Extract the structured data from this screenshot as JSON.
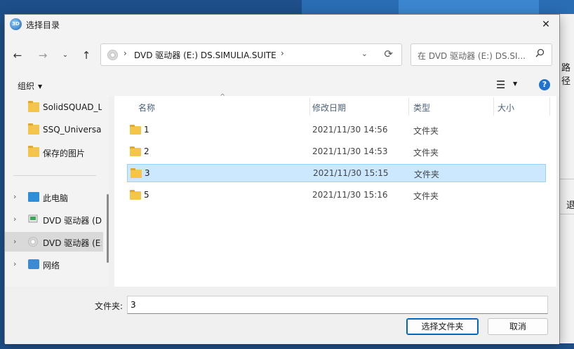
{
  "background": {
    "right_text_1": "路径",
    "right_text_2": "退"
  },
  "dialog": {
    "title": "选择目录",
    "close_glyph": "✕"
  },
  "nav": {
    "back": "←",
    "forward": "→",
    "dropdown": "⌄",
    "up": "↑"
  },
  "address": {
    "sep": "›",
    "path": "DVD 驱动器 (E:) DS.SIMULIA.SUITE",
    "dropdown": "⌄",
    "refresh": "⟳"
  },
  "search": {
    "placeholder": "在 DVD 驱动器 (E:) DS.SI...",
    "icon": "search-icon"
  },
  "toolbar": {
    "organize_label": "组织",
    "organize_caret": "▼",
    "view_glyph": "☰",
    "view_caret": "▼",
    "help_glyph": "?"
  },
  "navpane": {
    "items": [
      {
        "label": "SolidSQUAD_Li",
        "icon": "folder-icon",
        "chevron": ""
      },
      {
        "label": "SSQ_UniversalI",
        "icon": "folder-icon",
        "chevron": ""
      },
      {
        "label": "保存的图片",
        "icon": "folder-icon",
        "chevron": ""
      },
      {
        "label": "此电脑",
        "icon": "computer-icon",
        "chevron": "›"
      },
      {
        "label": "DVD 驱动器 (D",
        "icon": "dvd-installer-icon",
        "chevron": "›"
      },
      {
        "label": "DVD 驱动器 (E:",
        "icon": "dvd-drive-icon",
        "chevron": "›"
      },
      {
        "label": "网络",
        "icon": "network-icon",
        "chevron": "›"
      }
    ]
  },
  "filelist": {
    "columns": [
      "名称",
      "修改日期",
      "类型",
      "大小"
    ],
    "sort_glyph": "^",
    "rows": [
      {
        "name": "1",
        "date": "2021/11/30 14:56",
        "type": "文件夹",
        "size": ""
      },
      {
        "name": "2",
        "date": "2021/11/30 14:53",
        "type": "文件夹",
        "size": ""
      },
      {
        "name": "3",
        "date": "2021/11/30 15:15",
        "type": "文件夹",
        "size": "",
        "selected": true
      },
      {
        "name": "5",
        "date": "2021/11/30 15:16",
        "type": "文件夹",
        "size": ""
      }
    ]
  },
  "footer": {
    "folder_label": "文件夹:",
    "folder_value": "3",
    "select_button": "选择文件夹",
    "cancel_button": "取消"
  },
  "colors": {
    "accent": "#0067c0",
    "selection_bg": "#cce8ff",
    "selection_border": "#99d1ff",
    "folder": "#f5c54a",
    "help": "#1e73d2"
  }
}
